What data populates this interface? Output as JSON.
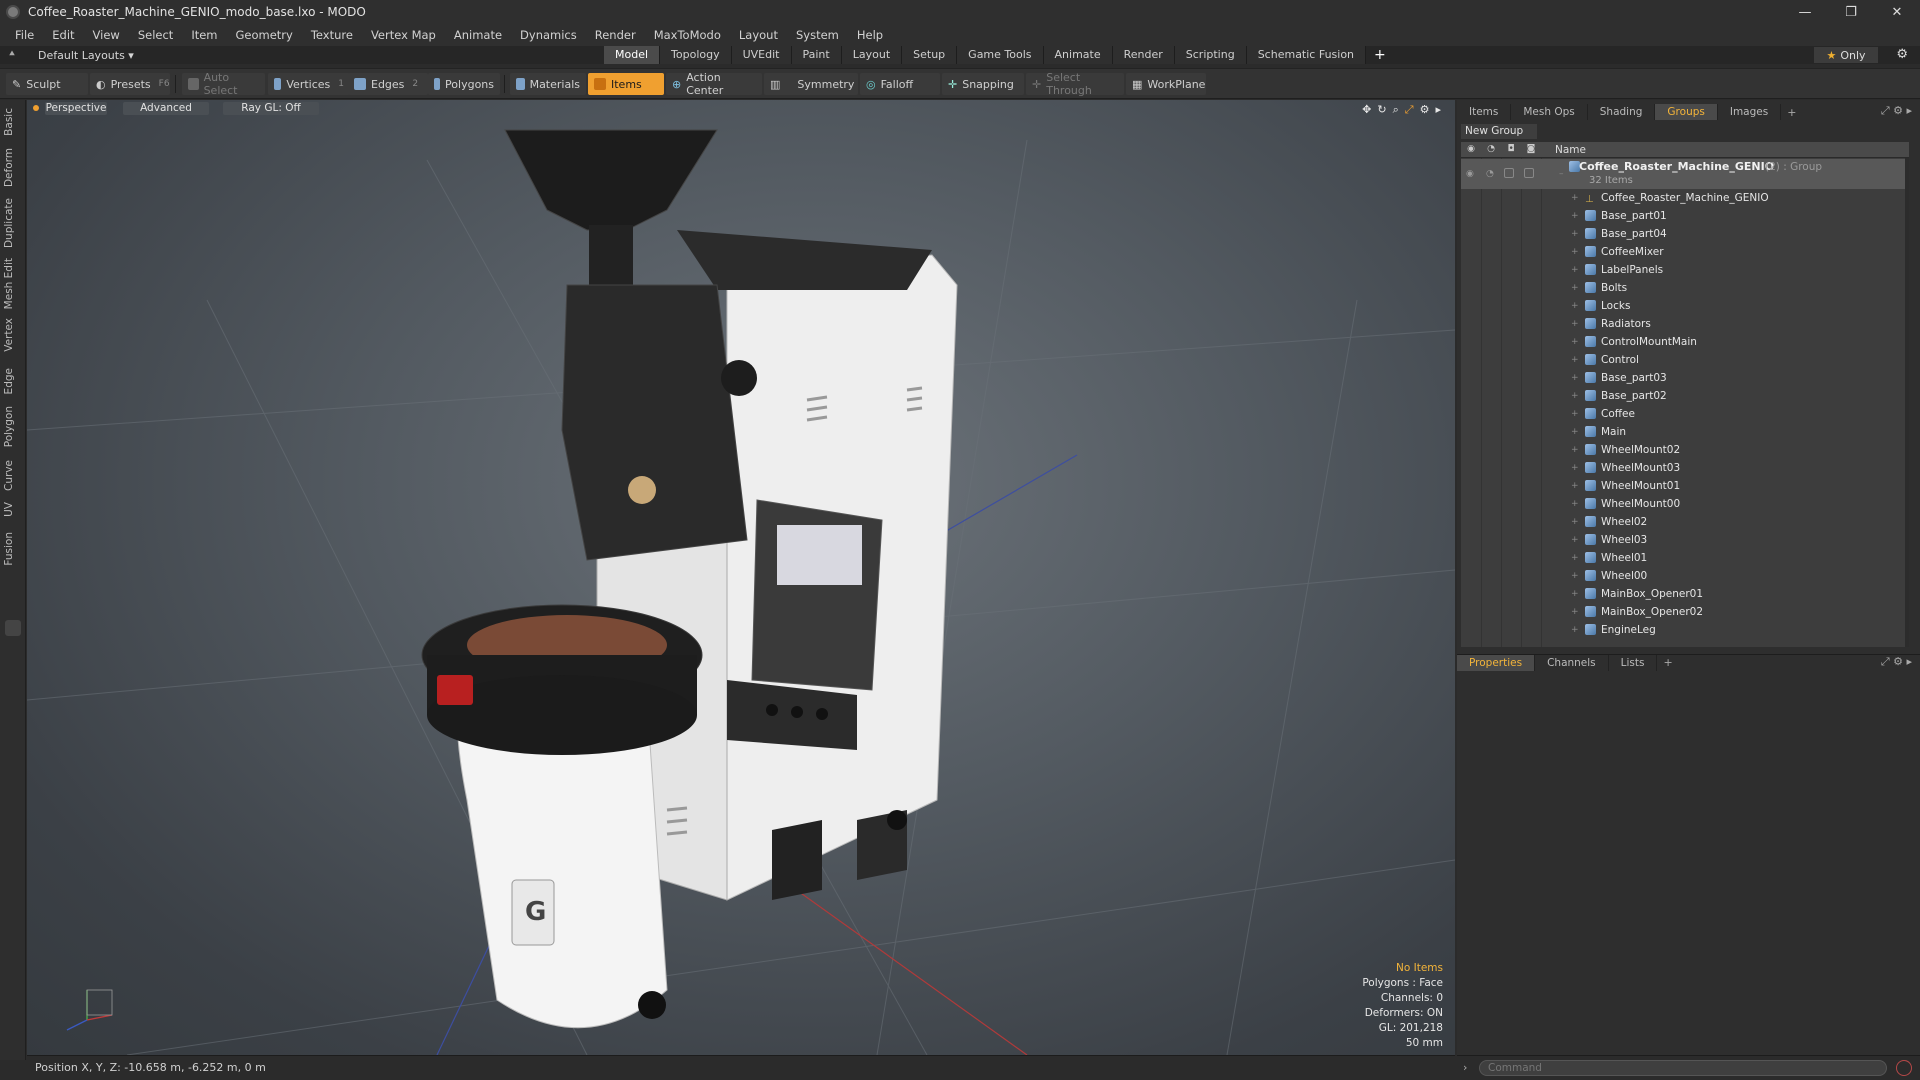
{
  "window": {
    "title": "Coffee_Roaster_Machine_GENIO_modo_base.lxo - MODO",
    "controls": {
      "minimize": "—",
      "restore": "❐",
      "close": "✕"
    }
  },
  "menu": [
    "File",
    "Edit",
    "View",
    "Select",
    "Item",
    "Geometry",
    "Texture",
    "Vertex Map",
    "Animate",
    "Dynamics",
    "Render",
    "MaxToModo",
    "Layout",
    "System",
    "Help"
  ],
  "layout": {
    "dropdown": "Default Layouts ▾",
    "tabs": [
      "Model",
      "Topology",
      "UVEdit",
      "Paint",
      "Layout",
      "Setup",
      "Game Tools",
      "Animate",
      "Render",
      "Scripting",
      "Schematic Fusion"
    ],
    "active_tab": "Model",
    "add_tab": "+",
    "only_label": "Only"
  },
  "toolbar": {
    "sculpt": "Sculpt",
    "presets": "Presets",
    "presets_hotkey": "F6",
    "auto_select": "Auto Select",
    "vertices": "Vertices",
    "vertices_hotkey": "1",
    "edges": "Edges",
    "edges_hotkey": "2",
    "polygons": "Polygons",
    "materials": "Materials",
    "items": "Items",
    "action_center": "Action Center",
    "symmetry": "Symmetry",
    "falloff": "Falloff",
    "snapping": "Snapping",
    "select_through": "Select Through",
    "workplane": "WorkPlane"
  },
  "left_tabs": [
    "Basic",
    "Deform",
    "Duplicate",
    "Mesh Edit",
    "Vertex",
    "Edge",
    "Polygon",
    "Curve",
    "UV",
    "Fusion"
  ],
  "viewport": {
    "perspective": "Perspective",
    "advanced": "Advanced",
    "raygl": "Ray GL: Off",
    "info": {
      "no_items": "No Items",
      "polygons": "Polygons : Face",
      "channels": "Channels: 0",
      "deformers": "Deformers: ON",
      "gl": "GL: 201,218",
      "scale": "50 mm"
    }
  },
  "status": {
    "position": "Position X, Y, Z:   -10.658 m, -6.252 m, 0 m"
  },
  "right_panel": {
    "tabs": [
      "Items",
      "Mesh Ops",
      "Shading",
      "Groups",
      "Images"
    ],
    "active_tab": "Groups",
    "new_group": "New Group",
    "col_name": "Name",
    "group": {
      "name": "Coffee_Roaster_Machine_GENIO",
      "type": "(2) : Group",
      "count": "32 Items"
    },
    "items": [
      "Coffee_Roaster_Machine_GENIO",
      "Base_part01",
      "Base_part04",
      "CoffeeMixer",
      "LabelPanels",
      "Bolts",
      "Locks",
      "Radiators",
      "ControlMountMain",
      "Control",
      "Base_part03",
      "Base_part02",
      "Coffee",
      "Main",
      "WheelMount02",
      "WheelMount03",
      "WheelMount01",
      "WheelMount00",
      "Wheel02",
      "Wheel03",
      "Wheel01",
      "Wheel00",
      "MainBox_Opener01",
      "MainBox_Opener02",
      "EngineLeg"
    ],
    "props_tabs": [
      "Properties",
      "Channels",
      "Lists"
    ],
    "props_active": "Properties",
    "command_placeholder": "Command"
  },
  "colors": {
    "accent": "#f0a030",
    "highlight_text": "#f3b43a",
    "viewport_bg": "#535a61"
  }
}
